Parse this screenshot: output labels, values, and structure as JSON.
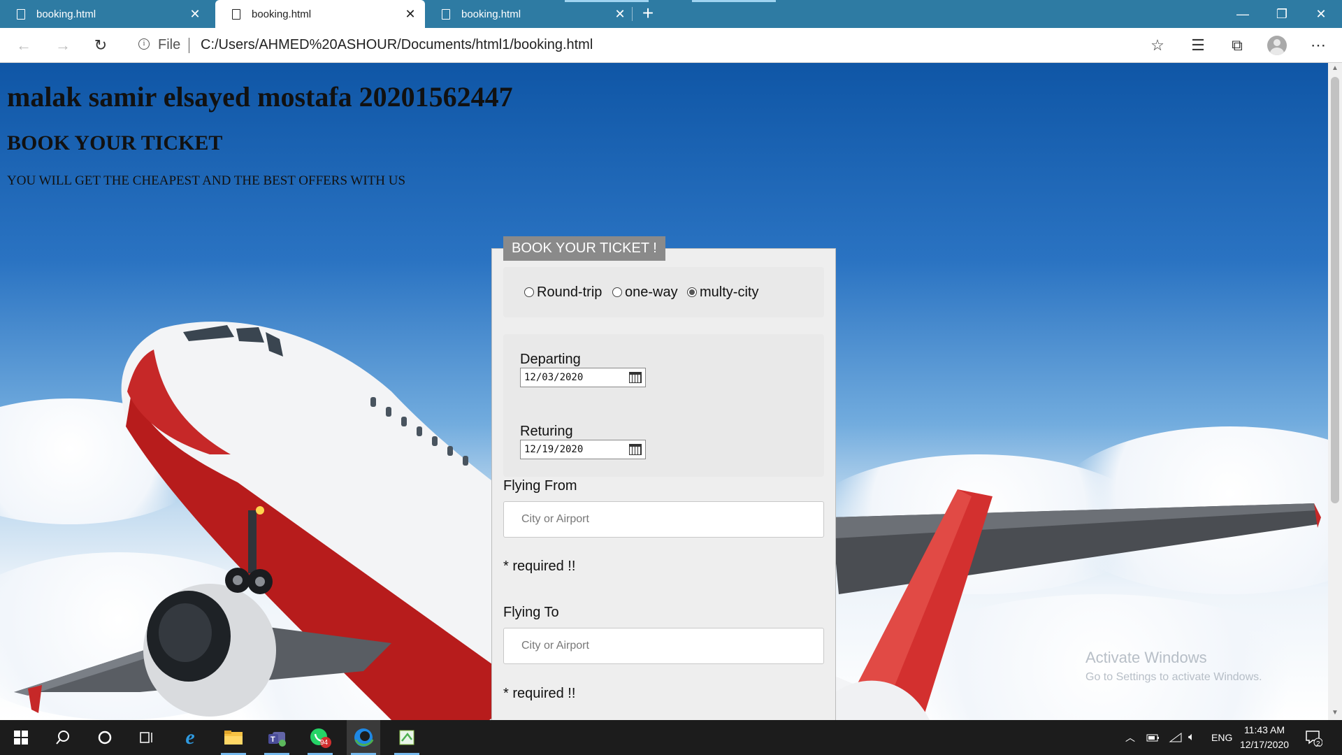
{
  "browser": {
    "tabs": [
      {
        "label": "booking.html",
        "active": false
      },
      {
        "label": "booking.html",
        "active": true
      },
      {
        "label": "booking.html",
        "active": false
      }
    ],
    "address": {
      "scheme": "File",
      "url": "C:/Users/AHMED%20ASHOUR/Documents/html1/booking.html"
    }
  },
  "page": {
    "name_heading": "malak samir elsayed mostafa 20201562447",
    "book_heading": "BOOK YOUR TICKET",
    "offer_text": "YOU WILL GET THE CHEAPEST AND THE BEST OFFERS WITH US"
  },
  "form": {
    "legend": "BOOK YOUR TICKET !",
    "trip_options": [
      {
        "label": "Round-trip",
        "checked": false
      },
      {
        "label": "one-way",
        "checked": false
      },
      {
        "label": "multy-city",
        "checked": true
      }
    ],
    "departing": {
      "label": "Departing",
      "value": "12/03/2020"
    },
    "returning": {
      "label": "Returing",
      "value": "12/19/2020"
    },
    "flying_from": {
      "label": "Flying From",
      "placeholder": "City or Airport",
      "note": "* required !!"
    },
    "flying_to": {
      "label": "Flying To",
      "placeholder": "City or Airport",
      "note": "* required !!"
    }
  },
  "watermark": {
    "line1": "Activate Windows",
    "line2": "Go to Settings to activate Windows."
  },
  "taskbar": {
    "language": "ENG",
    "time": "11:43 AM",
    "date": "12/17/2020",
    "whatsapp_badge": "94",
    "notification_count": "2"
  },
  "colors": {
    "tab_bar": "#2e7ba3",
    "form_legend": "#8a8a8a",
    "form_background": "#eeeeee",
    "taskbar": "#1c1c1c"
  }
}
